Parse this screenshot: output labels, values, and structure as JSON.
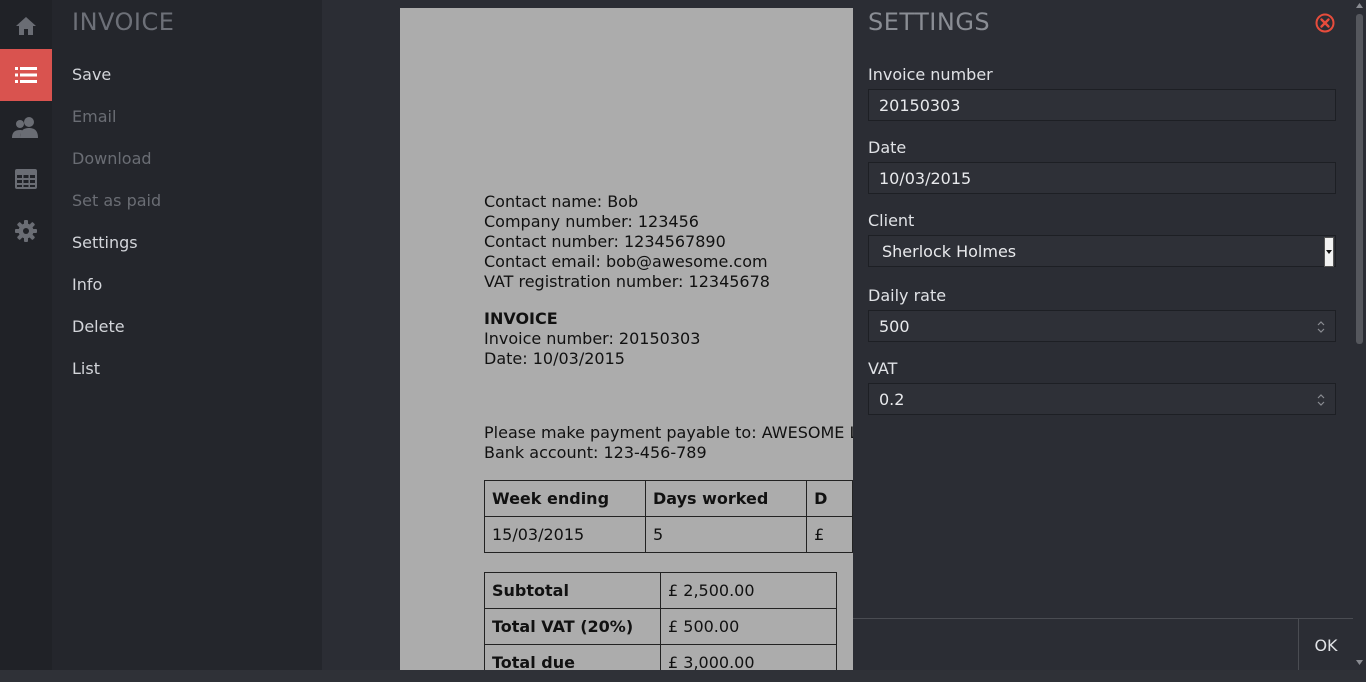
{
  "menu": {
    "title": "INVOICE",
    "items": [
      {
        "label": "Save",
        "enabled": true
      },
      {
        "label": "Email",
        "enabled": false
      },
      {
        "label": "Download",
        "enabled": false
      },
      {
        "label": "Set as paid",
        "enabled": false
      },
      {
        "label": "Settings",
        "enabled": true
      },
      {
        "label": "Info",
        "enabled": true
      },
      {
        "label": "Delete",
        "enabled": true
      },
      {
        "label": "List",
        "enabled": true
      }
    ]
  },
  "rail": {
    "icons": [
      "home-icon",
      "list-icon",
      "users-icon",
      "calendar-icon",
      "gear-icon"
    ],
    "active": "list-icon",
    "accent": "#d9534f"
  },
  "document": {
    "contact_lines": [
      "Contact name: Bob",
      "Company number: 123456",
      "Contact number: 1234567890",
      "Contact email: bob@awesome.com",
      "VAT registration number: 12345678"
    ],
    "heading": "INVOICE",
    "invoice_number_line": "Invoice number: 20150303",
    "date_line": "Date: 10/03/2015",
    "payment_line": "Please make payment payable to: AWESOME LTD",
    "bank_line": "Bank account: 123-456-789",
    "table": {
      "headers": [
        "Week ending",
        "Days worked",
        "D"
      ],
      "rows": [
        [
          "15/03/2015",
          "5",
          "£"
        ]
      ]
    },
    "totals": [
      {
        "label": "Subtotal",
        "value": "£ 2,500.00"
      },
      {
        "label": "Total VAT (20%)",
        "value": "£ 500.00"
      },
      {
        "label": "Total due",
        "value": "£ 3,000.00"
      }
    ]
  },
  "settings": {
    "title": "SETTINGS",
    "invoice_number_label": "Invoice number",
    "invoice_number_value": "20150303",
    "date_label": "Date",
    "date_value": "10/03/2015",
    "client_label": "Client",
    "client_value": "Sherlock Holmes",
    "daily_rate_label": "Daily rate",
    "daily_rate_value": "500",
    "vat_label": "VAT",
    "vat_value": "0.2",
    "ok_label": "OK",
    "close_color": "#e74c3c"
  }
}
